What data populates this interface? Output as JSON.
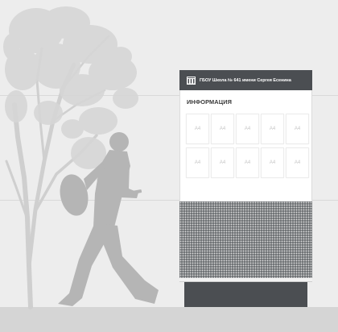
{
  "colors": {
    "background": "#ededed",
    "ground": "#d5d5d5",
    "sign_dark": "#4b4e52",
    "sheet_label": "#c6c6c6",
    "tree": "#d6d6d6",
    "person": "#b5b5b5"
  },
  "sign": {
    "header": {
      "icon": "school-building-icon",
      "text": "ГБОУ Школа № 641 имени Сергея Есенина"
    },
    "title": "ИНФОРМАЦИЯ",
    "sheets": [
      "A4",
      "A4",
      "A4",
      "A4",
      "A4",
      "A4",
      "A4",
      "A4",
      "A4",
      "A4"
    ]
  }
}
